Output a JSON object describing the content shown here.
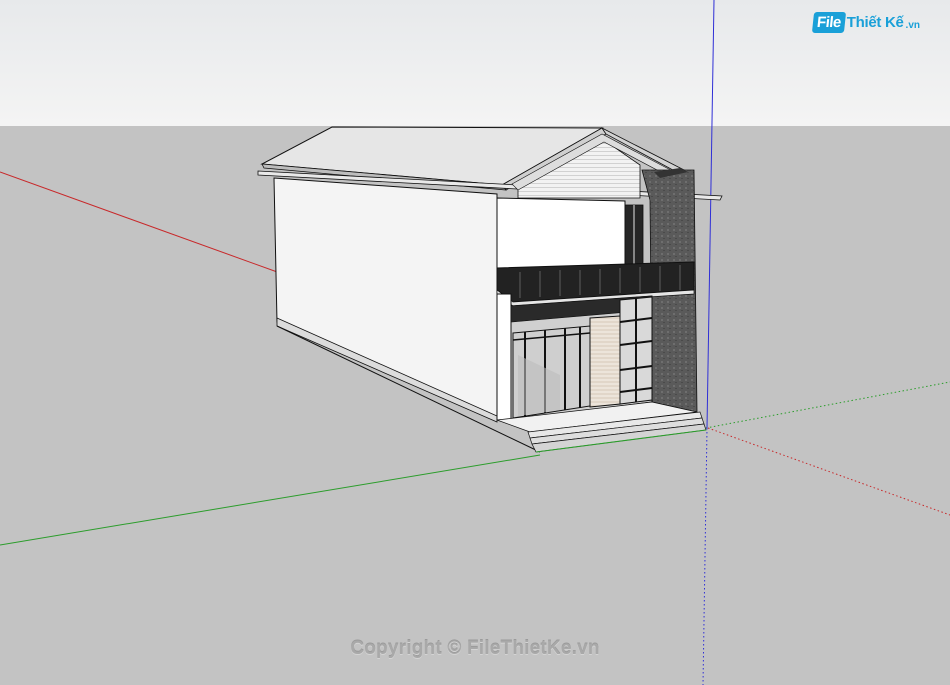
{
  "logo": {
    "file_text": "File",
    "brand_text": "Thiết Kế",
    "tld_text": ".vn"
  },
  "watermark": "Copyright © FileThietKe.vn",
  "colors": {
    "sky_top": "#e9ebed",
    "sky_bottom": "#f3f3f3",
    "ground": "#c3c3c3",
    "axis_red": "#c8282a",
    "axis_green": "#2b9d2b",
    "axis_blue": "#2f2fd6",
    "logo_blue": "#1aa0d8"
  }
}
